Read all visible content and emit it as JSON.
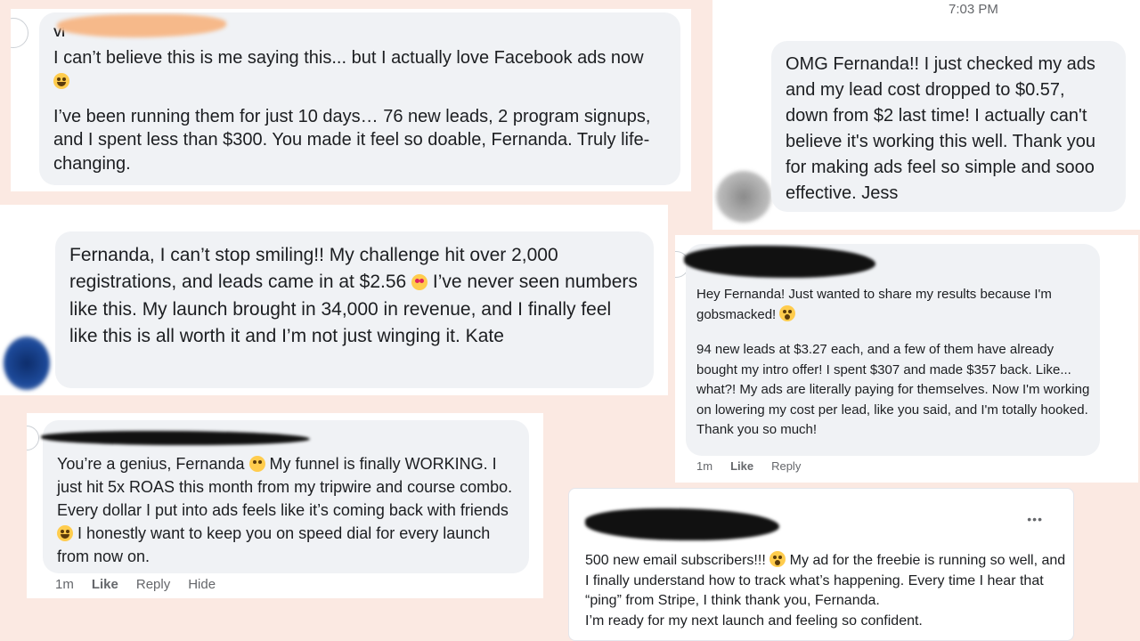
{
  "card1": {
    "name_partial": "Vi",
    "text1": "I can’t believe this is me saying this... but I actually love Facebook ads now",
    "text2": "I’ve been running them for just 10 days… 76 new leads, 2 program signups, and I spent less than $300. You made it feel so doable, Fernanda. Truly life-changing.",
    "emoji": "laughing-face-icon"
  },
  "card2": {
    "timestamp": "7:03 PM",
    "text": "OMG Fernanda!! I just checked my ads and my lead cost dropped to $0.57, down from $2 last time! I actually can't believe it's working this well. Thank you for making ads feel so simple and sooo effective. Jess"
  },
  "card3": {
    "text_before": "Fernanda, I can’t stop smiling!! My challenge hit over 2,000 registrations, and leads came in at $2.56",
    "text_after": "I’ve never seen numbers like this. My launch brought in 34,000 in revenue, and I finally feel like this is all worth it and I’m not just winging it. Kate",
    "emoji": "heart-eyes-icon"
  },
  "card4": {
    "text1": "Hey Fernanda! Just wanted to share my results because I'm gobsmacked!",
    "text2": "94 new leads at $3.27 each, and a few of them have already bought my intro offer! I spent $307 and made $357 back. Like... what?! My ads are literally paying for themselves. Now I'm working on lowering my cost per lead, like you said, and I'm totally hooked. Thank you so much!",
    "time": "1m",
    "like": "Like",
    "reply": "Reply",
    "emoji": "astonished-face-icon"
  },
  "card5": {
    "text_before": "You’re a genius, Fernanda",
    "text_middle": "My funnel is finally WORKING. I just hit 5x ROAS this month from my tripwire and course combo. Every dollar I put into ads feels like it’s coming back with friends",
    "text_after": "I honestly want to keep you on speed dial for every launch from now on.",
    "time": "1m",
    "like": "Like",
    "reply": "Reply",
    "hide": "Hide",
    "emoji1": "praising-hands-icon",
    "emoji2": "laughing-face-icon"
  },
  "card6": {
    "menu": "•••",
    "text_before": "500 new email subscribers!!!",
    "text_after": "My ad for the freebie is running so well, and I finally understand how to track what’s happening. Every time I hear that “ping” from Stripe, I think thank you, Fernanda.",
    "text2": "I’m ready for my next launch and feeling so confident.",
    "emoji": "astonished-face-icon"
  }
}
